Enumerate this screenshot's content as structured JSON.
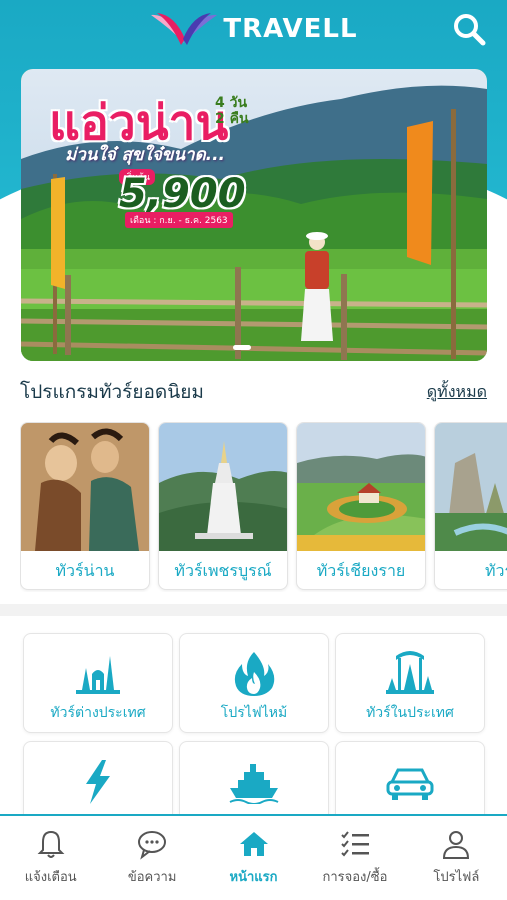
{
  "app": {
    "brand": "TRAVELL"
  },
  "header": {
    "search_icon": "search-icon"
  },
  "banner": {
    "title": "แอ่วน่าน",
    "days_line1": "4 วัน",
    "days_line2": "2 คืน",
    "subtitle": "ม่วนใจ๋ สุขใจ๋ขนาด...",
    "badge": "เริ่มต้น",
    "price": "5,900",
    "period": "เดือน : ก.ย. - ธ.ค. 2563"
  },
  "popular": {
    "title": "โปรแกรมทัวร์ยอดนิยม",
    "see_all": "ดูทั้งหมด",
    "tours": [
      {
        "label": "ทัวร์น่าน"
      },
      {
        "label": "ทัวร์เพชรบูรณ์"
      },
      {
        "label": "ทัวร์เชียงราย"
      },
      {
        "label": "ทัวร์"
      }
    ]
  },
  "categories": [
    {
      "label": "ทัวร์ต่างประเทศ",
      "icon": "world-landmarks-icon"
    },
    {
      "label": "โปรไฟไหม้",
      "icon": "fire-icon"
    },
    {
      "label": "ทัวร์ในประเทศ",
      "icon": "thai-landmarks-icon"
    },
    {
      "label": "",
      "icon": "lightning-icon"
    },
    {
      "label": "",
      "icon": "cruise-ship-icon"
    },
    {
      "label": "",
      "icon": "car-icon"
    }
  ],
  "nav": {
    "items": [
      {
        "label": "แจ้งเตือน",
        "icon": "bell-icon"
      },
      {
        "label": "ข้อความ",
        "icon": "chat-icon"
      },
      {
        "label": "หน้าแรก",
        "icon": "home-icon"
      },
      {
        "label": "การจอง/ซื้อ",
        "icon": "checklist-icon"
      },
      {
        "label": "โปรไฟล์",
        "icon": "user-icon"
      }
    ],
    "active_index": 2
  },
  "colors": {
    "primary": "#1aa9c4",
    "accent": "#e91e63"
  }
}
